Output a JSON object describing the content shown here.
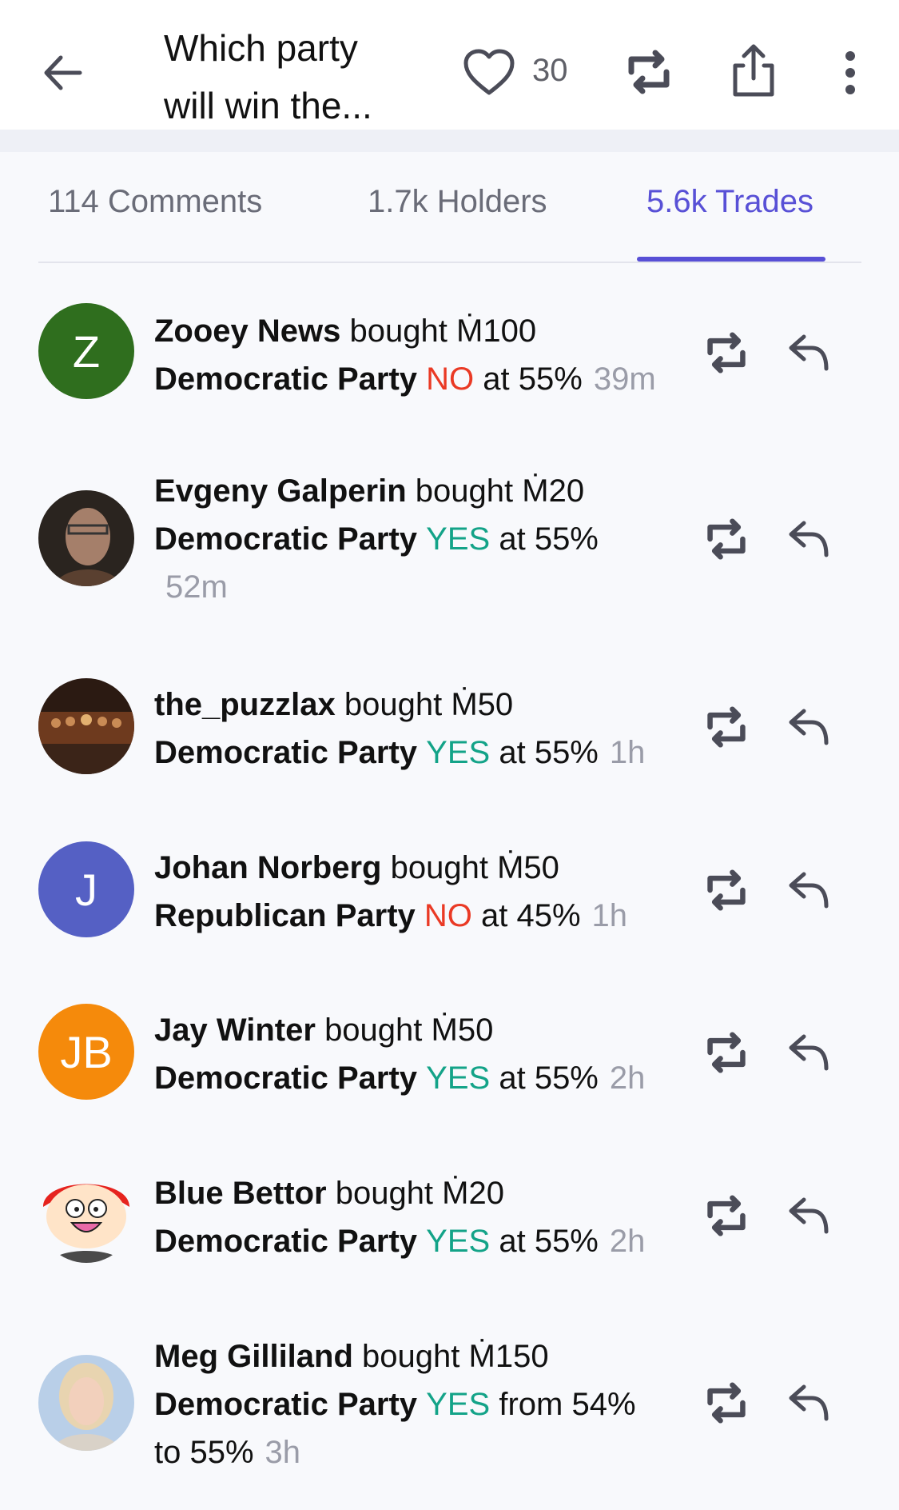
{
  "header": {
    "title_line1": "Which party",
    "title_line2": "will win the...",
    "like_count": "30"
  },
  "tabs": [
    {
      "label": "114 Comments",
      "active": false
    },
    {
      "label": "1.7k Holders",
      "active": false
    },
    {
      "label": "5.6k Trades",
      "active": true
    }
  ],
  "colors": {
    "accent": "#5850d6",
    "yes": "#13a388",
    "no": "#ea3a25",
    "muted": "#9a9ca8"
  },
  "trades": [
    {
      "user": "Zooey News",
      "verb": "bought",
      "amount": "Ṁ100",
      "party": "Democratic Party",
      "outcome": "NO",
      "price_text": "at 55%",
      "time": "39m",
      "avatar": {
        "type": "initials",
        "text": "Z",
        "color": "#2f6e1e"
      }
    },
    {
      "user": "Evgeny Galperin",
      "verb": "bought",
      "amount": "Ṁ20",
      "party": "Democratic Party",
      "outcome": "YES",
      "price_text": "at 55%",
      "time": "52m",
      "avatar": {
        "type": "photo"
      }
    },
    {
      "user": "the_puzzlax",
      "verb": "bought",
      "amount": "Ṁ50",
      "party": "Democratic Party",
      "outcome": "YES",
      "price_text": "at 55%",
      "time": "1h",
      "avatar": {
        "type": "photo"
      }
    },
    {
      "user": "Johan Norberg",
      "verb": "bought",
      "amount": "Ṁ50",
      "party": "Republican Party",
      "outcome": "NO",
      "price_text": "at 45%",
      "time": "1h",
      "avatar": {
        "type": "initials",
        "text": "J",
        "color": "#5560c4"
      }
    },
    {
      "user": "Jay Winter",
      "verb": "bought",
      "amount": "Ṁ50",
      "party": "Democratic Party",
      "outcome": "YES",
      "price_text": "at 55%",
      "time": "2h",
      "avatar": {
        "type": "initials",
        "text": "JB",
        "color": "#f58a0b"
      }
    },
    {
      "user": "Blue Bettor",
      "verb": "bought",
      "amount": "Ṁ20",
      "party": "Democratic Party",
      "outcome": "YES",
      "price_text": "at 55%",
      "time": "2h",
      "avatar": {
        "type": "cartoon"
      }
    },
    {
      "user": "Meg Gilliland",
      "verb": "bought",
      "amount": "Ṁ150",
      "party": "Democratic Party",
      "outcome": "YES",
      "price_text": "from 54%",
      "price_text2": "to 55%",
      "time": "3h",
      "avatar": {
        "type": "photo"
      }
    }
  ]
}
